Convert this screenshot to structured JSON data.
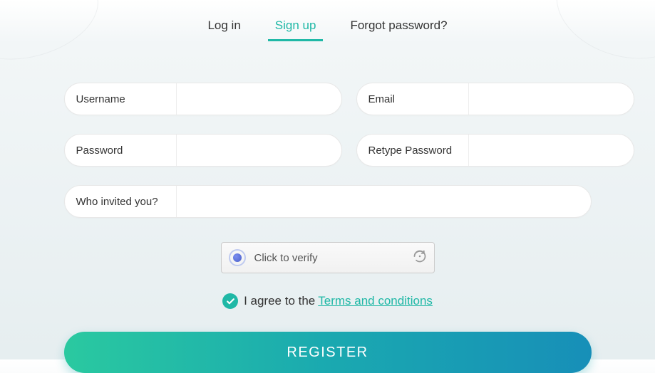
{
  "tabs": {
    "login": "Log in",
    "signup": "Sign up",
    "forgot": "Forgot password?"
  },
  "fields": {
    "username": {
      "label": "Username",
      "value": ""
    },
    "email": {
      "label": "Email",
      "value": ""
    },
    "password": {
      "label": "Password",
      "value": ""
    },
    "retype": {
      "label": "Retype Password",
      "value": ""
    },
    "referrer": {
      "label": "Who invited you?",
      "value": ""
    }
  },
  "captcha": {
    "text": "Click to verify"
  },
  "terms": {
    "prefix": "I agree to the",
    "link": "Terms and conditions",
    "checked": true
  },
  "register_button": "REGISTER",
  "colors": {
    "accent": "#1fb8a6"
  }
}
